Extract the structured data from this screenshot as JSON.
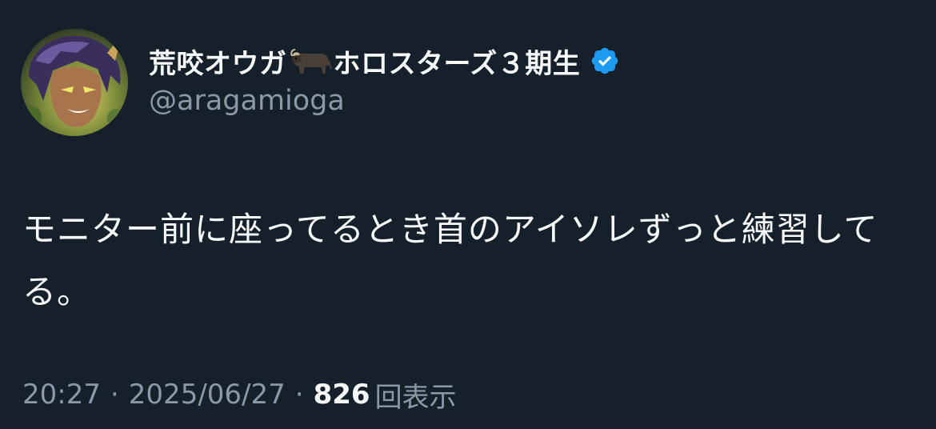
{
  "author": {
    "display_name": "荒咬オウガ",
    "display_name_suffix": "ホロスターズ３期生",
    "emoji": "water-buffalo-icon",
    "handle": "@aragamioga",
    "verified": true,
    "verified_color": "#1d9bf0"
  },
  "tweet": {
    "text": "モニター前に座ってるとき首のアイソレずっと練習してる。"
  },
  "meta": {
    "time": "20:27",
    "separator": "·",
    "date": "2025/06/27",
    "views_count": "826",
    "views_label": "回表示"
  },
  "colors": {
    "background": "#15202b",
    "primary_text": "#f7f9f9",
    "secondary_text": "#8b98a5"
  }
}
